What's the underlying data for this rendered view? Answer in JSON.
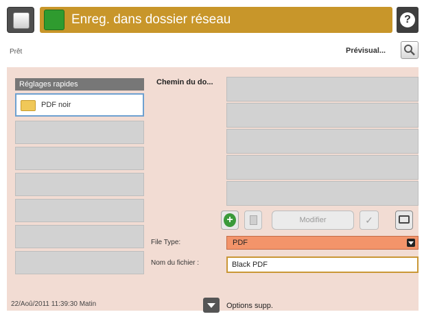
{
  "header": {
    "title": "Enreg. dans dossier réseau",
    "help_glyph": "?",
    "icons": [
      "home-icon",
      "start-icon",
      "help-icon"
    ]
  },
  "status": {
    "text": "Prêt",
    "preview_label": "Prévisual..."
  },
  "quick_sets": {
    "header": "Réglages rapides",
    "items": [
      "PDF noir",
      "",
      "",
      "",
      "",
      "",
      ""
    ]
  },
  "path": {
    "label": "Chemin du do..."
  },
  "toolbar": {
    "add_glyph": "+",
    "modify_label": "Modifier",
    "check_glyph": "✓"
  },
  "file_type": {
    "label": "File Type:",
    "value": "PDF"
  },
  "file_name": {
    "label": "Nom du fichier :",
    "value": "Black PDF"
  },
  "footer": {
    "datetime": "22/Aoû/2011 11:39:30 Matin",
    "options_label": "Options supp."
  },
  "colors": {
    "title_bar": "#c8962a",
    "panel_bg": "#f2dcd3",
    "file_type_bg": "#f3946a",
    "input_border": "#c99634"
  }
}
